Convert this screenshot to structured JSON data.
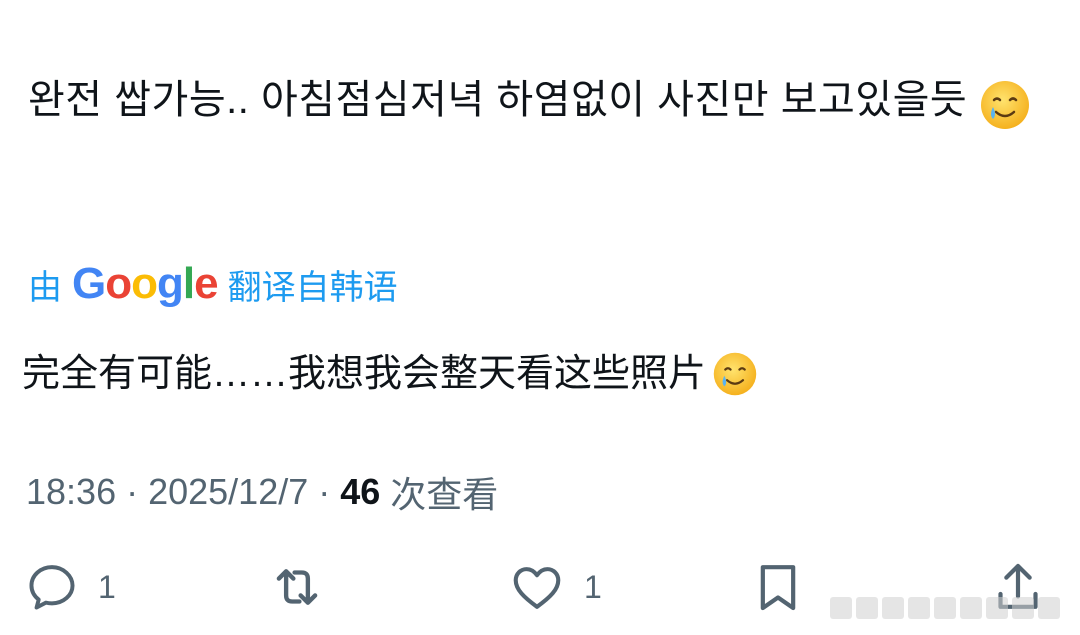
{
  "tweet": {
    "original_text": "완전 쌉가능.. 아침점심저녁 하염없이 사진만 보고있을듯",
    "original_emoji": "smiling-face-with-tear-emoji",
    "translation": {
      "prefix": "由",
      "brand_letters": [
        {
          "ch": "G",
          "color": "#4285F4"
        },
        {
          "ch": "o",
          "color": "#EA4335"
        },
        {
          "ch": "o",
          "color": "#FBBC05"
        },
        {
          "ch": "g",
          "color": "#4285F4"
        },
        {
          "ch": "l",
          "color": "#34A853"
        },
        {
          "ch": "e",
          "color": "#EA4335"
        }
      ],
      "suffix": "翻译自韩语",
      "link_color": "#1d9bf0"
    },
    "translated_text": "完全有可能……我想我会整天看这些照片",
    "meta": {
      "time": "18:36",
      "separator": " · ",
      "date": "2025/12/7",
      "views_count": "46",
      "views_label": "次查看"
    },
    "actions": {
      "reply": {
        "icon": "reply-icon",
        "count": "1"
      },
      "retweet": {
        "icon": "retweet-icon",
        "count": ""
      },
      "like": {
        "icon": "heart-icon",
        "count": "1"
      },
      "bookmark": {
        "icon": "bookmark-icon",
        "count": ""
      },
      "share": {
        "icon": "share-icon",
        "count": ""
      }
    }
  }
}
